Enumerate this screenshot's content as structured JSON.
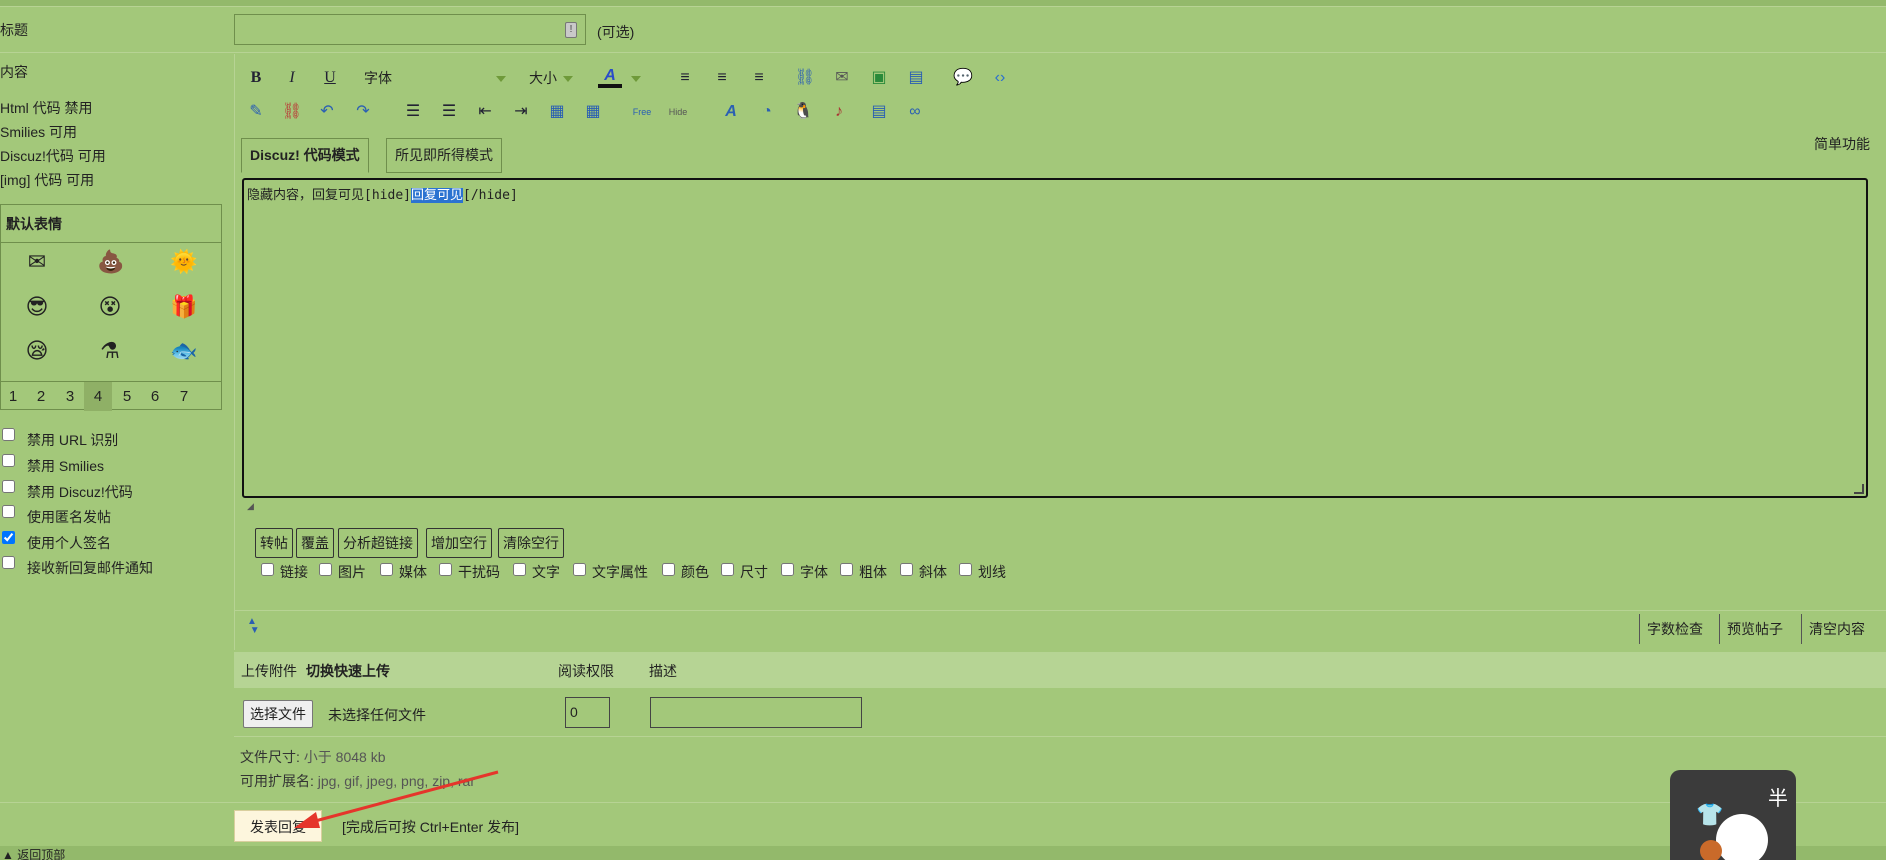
{
  "form": {
    "title_label": "标题",
    "title_value": "",
    "title_optional": "(可选)",
    "content_label": "内容",
    "status": [
      {
        "text": "Html 代码 禁用"
      },
      {
        "text": "Smilies 可用"
      },
      {
        "text": "Discuz!代码 可用"
      },
      {
        "text": "[img] 代码 可用"
      }
    ]
  },
  "smilies": {
    "heading": "默认表情",
    "icons": [
      "envelope-icon",
      "poop-icon",
      "sun-smile-icon",
      "sunglasses-icon",
      "dizzy-face-icon",
      "gift-icon",
      "sleepy-face-icon",
      "hookah-icon",
      "fish-icon"
    ],
    "pages": [
      "1",
      "2",
      "3",
      "4",
      "5",
      "6",
      "7"
    ],
    "active_page": "4"
  },
  "options": [
    {
      "label": "禁用 URL 识别",
      "checked": false
    },
    {
      "label": "禁用 Smilies",
      "checked": false
    },
    {
      "label": "禁用 Discuz!代码",
      "checked": false
    },
    {
      "label": "使用匿名发帖",
      "checked": false
    },
    {
      "label": "使用个人签名",
      "checked": true
    },
    {
      "label": "接收新回复邮件通知",
      "checked": false
    }
  ],
  "editor": {
    "toolbar": {
      "bold": "B",
      "italic": "I",
      "underline": "U",
      "font_select": "字体",
      "size_select": "大小",
      "color_glyph": "A"
    },
    "modes": {
      "code_mode": "Discuz! 代码模式",
      "wysiwyg_mode": "所见即所得模式"
    },
    "simple_label": "简单功能",
    "content_before": "隐藏内容，回复可见",
    "content_tag_open": "[hide]",
    "content_selected": "回复可见",
    "content_tag_close": "[/hide]",
    "actions": [
      "转帖",
      "覆盖",
      "分析超链接",
      "增加空行",
      "清除空行"
    ],
    "filters": [
      "链接",
      "图片",
      "媒体",
      "干扰码",
      "文字",
      "文字属性",
      "颜色",
      "尺寸",
      "字体",
      "粗体",
      "斜体",
      "划线"
    ],
    "bottom": {
      "word_check": "字数检查",
      "preview": "预览帖子",
      "clear": "清空内容"
    }
  },
  "upload": {
    "title": "上传附件",
    "toggle": "切换快速上传",
    "perm_header": "阅读权限",
    "desc_header": "描述",
    "choose_button": "选择文件",
    "no_file": "未选择任何文件",
    "perm_value": "0",
    "desc_value": "",
    "size_label": "文件尺寸:",
    "size_value": "小于 8048 kb",
    "ext_label": "可用扩展名:",
    "ext_value": "jpg, gif, jpeg, png, zip, rar"
  },
  "submit": {
    "label": "发表回复",
    "hint": "[完成后可按 Ctrl+Enter 发布]"
  },
  "footer": {
    "partial_text": "▲ 返回顶部"
  },
  "widget": {
    "label": "半"
  },
  "colors": {
    "background": "#a3c87a",
    "selection": "#2b73d1",
    "submit_bg": "#fdf6dd",
    "annotation_arrow": "#e5352b"
  }
}
